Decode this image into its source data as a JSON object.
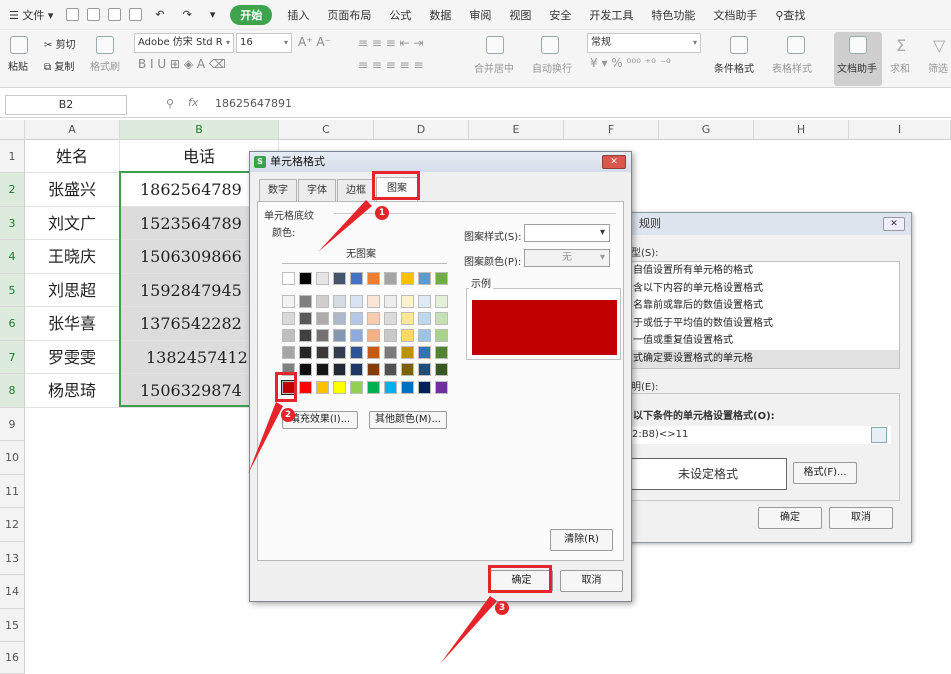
{
  "menubar": {
    "file": "文件",
    "start": "开始",
    "items": [
      "插入",
      "页面布局",
      "公式",
      "数据",
      "审阅",
      "视图",
      "安全",
      "开发工具",
      "特色功能",
      "文档助手"
    ],
    "search": "查找"
  },
  "ribbon": {
    "paste": "粘贴",
    "cut": "剪切",
    "copy": "复制",
    "format_painter": "格式刷",
    "font_name": "Adobe 仿宋 Std R",
    "font_size": "16",
    "number_format": "常规",
    "merge": "合并居中",
    "wrap": "自动换行",
    "cond_format": "条件格式",
    "table_style": "表格样式",
    "doc_assist": "文档助手",
    "sum": "求和",
    "filter": "筛选"
  },
  "formula": {
    "cell_ref": "B2",
    "fx": "fx",
    "value": "18625647891"
  },
  "columns": [
    "A",
    "B",
    "C",
    "D",
    "E",
    "F",
    "G",
    "H",
    "I"
  ],
  "rows": [
    "1",
    "2",
    "3",
    "4",
    "5",
    "6",
    "7",
    "8",
    "9",
    "10",
    "11",
    "12",
    "13",
    "14",
    "15",
    "16"
  ],
  "table": {
    "header": [
      "姓名",
      "电话"
    ],
    "rows": [
      [
        "张盛兴",
        "1862564789"
      ],
      [
        "刘文广",
        "1523564789"
      ],
      [
        "王晓庆",
        "1506309866"
      ],
      [
        "刘思超",
        "1592847945"
      ],
      [
        "张华喜",
        "1376542282"
      ],
      [
        "罗雯雯",
        "1382457412"
      ],
      [
        "杨思琦",
        "1506329874"
      ]
    ]
  },
  "cf_dialog": {
    "title": "规则",
    "type_label": "型(S):",
    "types": [
      "自值设置所有单元格的格式",
      "含以下内容的单元格设置格式",
      "名靠前或靠后的数值设置格式",
      "于或低于平均值的数值设置格式",
      "一值或重复值设置格式",
      "式确定要设置格式的单元格"
    ],
    "desc_label": "明(E):",
    "cond_label": "以下条件的单元格设置格式(O):",
    "expr": "2:B8)<>11",
    "preview": "未设定格式",
    "format_btn": "格式(F)...",
    "ok": "确定",
    "cancel": "取消"
  },
  "cell_dialog": {
    "title": "单元格格式",
    "tabs": [
      "数字",
      "字体",
      "边框",
      "图案"
    ],
    "group_label": "单元格底纹",
    "color_label": "颜色:",
    "no_pattern": "无图案",
    "pattern_style_label": "图案样式(S):",
    "pattern_color_label": "图案颜色(P):",
    "pattern_color_value": "无",
    "sample_label": "示例",
    "fill_effects": "填充效果(I)...",
    "more_colors": "其他颜色(M)...",
    "clear": "清除(R)",
    "ok": "确定",
    "cancel": "取消",
    "selected_color": "#c00000",
    "palette_top": [
      "#ffffff",
      "#000000",
      "#e7e6e6",
      "#44546a",
      "#4472c4",
      "#ed7d31",
      "#a5a5a5",
      "#ffc000",
      "#5b9bd5",
      "#70ad47"
    ],
    "palette_shades": [
      [
        "#f2f2f2",
        "#7f7f7f",
        "#d0cece",
        "#d6dce4",
        "#dae3f3",
        "#fbe5d6",
        "#ededed",
        "#fff2cc",
        "#deebf7",
        "#e2f0d9"
      ],
      [
        "#d9d9d9",
        "#595959",
        "#aeabab",
        "#adb9ca",
        "#b4c7e7",
        "#f8cbad",
        "#dbdbdb",
        "#ffe699",
        "#bdd7ee",
        "#c5e0b4"
      ],
      [
        "#bfbfbf",
        "#404040",
        "#757171",
        "#8497b0",
        "#8faadc",
        "#f4b183",
        "#c9c9c9",
        "#ffd966",
        "#9dc3e6",
        "#a9d18e"
      ],
      [
        "#a6a6a6",
        "#262626",
        "#3a3838",
        "#333f50",
        "#2f5597",
        "#c55a11",
        "#7b7b7b",
        "#bf9000",
        "#2e75b6",
        "#548235"
      ],
      [
        "#808080",
        "#0d0d0d",
        "#171616",
        "#222a35",
        "#203864",
        "#843c0c",
        "#525252",
        "#7f6000",
        "#1f4e79",
        "#385723"
      ]
    ],
    "palette_standard": [
      "#c00000",
      "#ff0000",
      "#ffc000",
      "#ffff00",
      "#92d050",
      "#00b050",
      "#00b0f0",
      "#0070c0",
      "#002060",
      "#7030a0"
    ]
  },
  "callouts": [
    "1",
    "2",
    "3"
  ]
}
